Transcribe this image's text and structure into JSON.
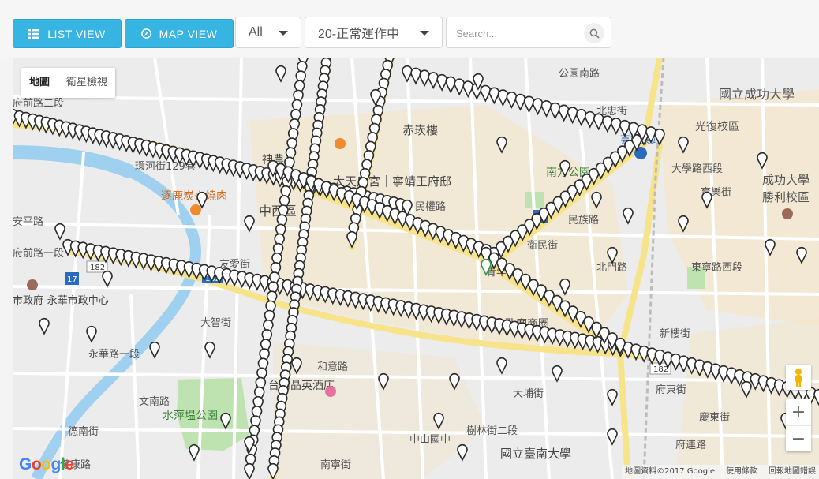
{
  "toolbar": {
    "list_view_label": "LIST VIEW",
    "map_view_label": "MAP VIEW",
    "category_select": "All",
    "status_select": "20-正常運作中",
    "search_placeholder": "Search..."
  },
  "map": {
    "type_map_label": "地圖",
    "type_satellite_label": "衛星檢視",
    "zoom_in_label": "+",
    "zoom_out_label": "−",
    "attribution": "地圖資料©2017 Google",
    "terms": "使用條款",
    "report": "回報地圖錯誤",
    "google_logo": "Google",
    "labels": [
      {
        "text": "國立成功大學",
        "kind": "area"
      },
      {
        "text": "光復校區",
        "kind": "area"
      },
      {
        "text": "大學路西段",
        "kind": "road"
      },
      {
        "text": "成功大學",
        "kind": "area"
      },
      {
        "text": "勝利校區",
        "kind": "area"
      },
      {
        "text": "育樂街",
        "kind": "road"
      },
      {
        "text": "東寧路西段",
        "kind": "road"
      },
      {
        "text": "臺南東站",
        "kind": "transit"
      },
      {
        "text": "北忠街",
        "kind": "road"
      },
      {
        "text": "公園南路",
        "kind": "road"
      },
      {
        "text": "南方公園",
        "kind": "park"
      },
      {
        "text": "赤崁樓",
        "kind": "poi"
      },
      {
        "text": "大天后宮｜寧靖王府邸",
        "kind": "poi"
      },
      {
        "text": "神農",
        "kind": "poi"
      },
      {
        "text": "逐鹿炭火燒肉",
        "kind": "restaurant"
      },
      {
        "text": "環河街129巷",
        "kind": "road"
      },
      {
        "text": "中西區",
        "kind": "area"
      },
      {
        "text": "民權路",
        "kind": "road"
      },
      {
        "text": "民族路",
        "kind": "road"
      },
      {
        "text": "衛民街",
        "kind": "road"
      },
      {
        "text": "青年路",
        "kind": "road"
      },
      {
        "text": "孔廟商圈",
        "kind": "poi"
      },
      {
        "text": "新樓街",
        "kind": "road"
      },
      {
        "text": "府東街",
        "kind": "road"
      },
      {
        "text": "大埔街",
        "kind": "road"
      },
      {
        "text": "樹林街二段",
        "kind": "road"
      },
      {
        "text": "國立臺南大學",
        "kind": "area"
      },
      {
        "text": "中山國中",
        "kind": "poi"
      },
      {
        "text": "南寧街",
        "kind": "road"
      },
      {
        "text": "和意路",
        "kind": "road"
      },
      {
        "text": "台南晶英酒店",
        "kind": "poi"
      },
      {
        "text": "水萍塭公園",
        "kind": "park"
      },
      {
        "text": "市政府-永華市政中心",
        "kind": "poi"
      },
      {
        "text": "永華路一段",
        "kind": "road"
      },
      {
        "text": "健康路",
        "kind": "road"
      },
      {
        "text": "府連路",
        "kind": "road"
      },
      {
        "text": "慶東街",
        "kind": "road"
      },
      {
        "text": "北門路",
        "kind": "road"
      },
      {
        "text": "大智街",
        "kind": "road"
      },
      {
        "text": "友愛街",
        "kind": "road"
      },
      {
        "text": "府前路二段",
        "kind": "road"
      },
      {
        "text": "文南路",
        "kind": "road"
      },
      {
        "text": "德南街",
        "kind": "road"
      },
      {
        "text": "府前路一段",
        "kind": "road"
      },
      {
        "text": "安平路",
        "kind": "road"
      }
    ],
    "route_shields": [
      "182",
      "17",
      "20",
      "182",
      "182"
    ]
  },
  "colors": {
    "accent": "#36b5e3",
    "marker": "#2b2b2b",
    "marker_selected": "#2e9e3c",
    "major_road": "#f7e38a",
    "river": "#9fd0f0",
    "park": "#bfe3b0",
    "district": "#f6e6c4"
  }
}
